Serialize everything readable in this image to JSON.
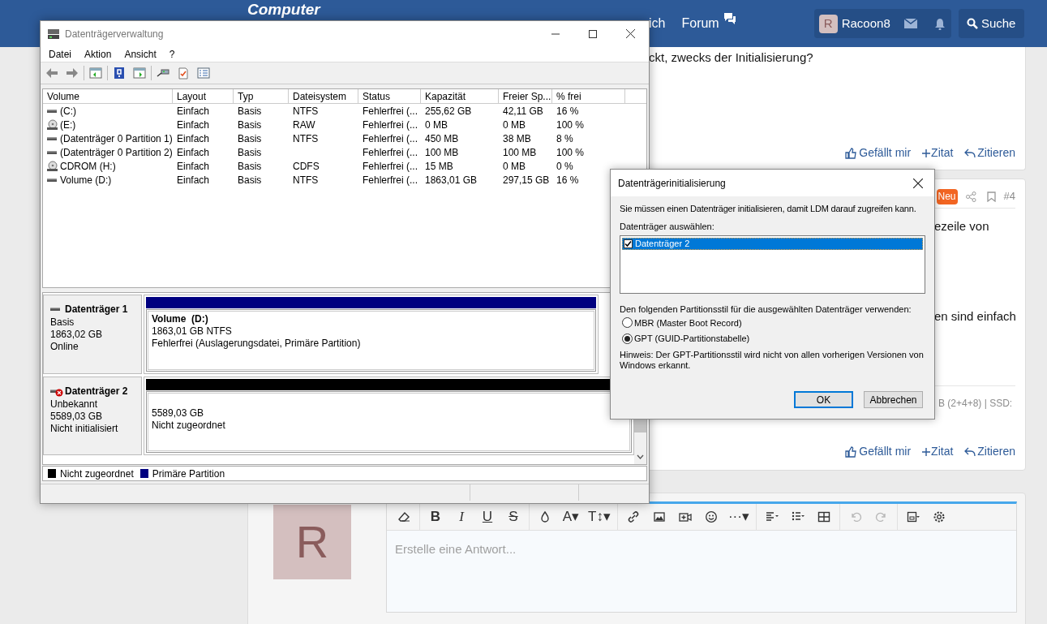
{
  "forum": {
    "logo": "Computer",
    "nav": [
      "ich",
      "Forum"
    ],
    "user": {
      "initial": "R",
      "name": "Racoon8"
    },
    "search": "Suche",
    "post1": {
      "text": "ckt, zwecks der Initialisierung?",
      "actions": [
        "Gefällt mir",
        "Zitat",
        "Zitieren"
      ]
    },
    "post2": {
      "badge": "Neu",
      "number": "#4",
      "lines": [
        "ezeile von",
        "en sind einfach"
      ],
      "signature": "B (2+4+8) | SSD:",
      "actions": [
        "Gefällt mir",
        "Zitat",
        "Zitieren"
      ]
    },
    "reply": {
      "avatar": "R",
      "placeholder": "Erstelle eine Antwort...",
      "tools": [
        {
          "kind": "eraser",
          "disabled": false
        },
        {
          "kind": "text",
          "label": "B",
          "disabled": false
        },
        {
          "kind": "text",
          "label": "I",
          "disabled": false
        },
        {
          "kind": "text",
          "label": "U",
          "disabled": false
        },
        {
          "kind": "text",
          "label": "S",
          "disabled": false
        },
        {
          "kind": "drop",
          "disabled": false
        },
        {
          "kind": "text",
          "label": "A▾",
          "disabled": false
        },
        {
          "kind": "text",
          "label": "T↕▾",
          "disabled": false
        },
        {
          "kind": "link",
          "disabled": false
        },
        {
          "kind": "image",
          "disabled": false
        },
        {
          "kind": "video",
          "disabled": false
        },
        {
          "kind": "smiley",
          "disabled": false
        },
        {
          "kind": "text",
          "label": "···▾",
          "disabled": false
        },
        {
          "kind": "align",
          "disabled": false
        },
        {
          "kind": "list",
          "disabled": false
        },
        {
          "kind": "table",
          "disabled": false
        },
        {
          "kind": "undo",
          "disabled": true
        },
        {
          "kind": "redo",
          "disabled": true
        },
        {
          "kind": "save",
          "disabled": false
        },
        {
          "kind": "gear",
          "disabled": false
        }
      ]
    }
  },
  "disk_window": {
    "title": "Datenträgerverwaltung",
    "menu": [
      "Datei",
      "Aktion",
      "Ansicht",
      "?"
    ],
    "columns": [
      "Volume",
      "Layout",
      "Typ",
      "Dateisystem",
      "Status",
      "Kapazität",
      "Freier Sp...",
      "% frei"
    ],
    "rows": [
      {
        "kind": "drive",
        "cells": [
          "(C:)",
          "Einfach",
          "Basis",
          "NTFS",
          "Fehlerfrei (...",
          "255,62 GB",
          "42,11 GB",
          "16 %"
        ]
      },
      {
        "kind": "cdrom",
        "cells": [
          "(E:)",
          "Einfach",
          "Basis",
          "RAW",
          "Fehlerfrei (...",
          "0 MB",
          "0 MB",
          "100 %"
        ]
      },
      {
        "kind": "drive",
        "cells": [
          "(Datenträger 0 Partition 1)",
          "Einfach",
          "Basis",
          "NTFS",
          "Fehlerfrei (...",
          "450 MB",
          "38 MB",
          "8 %"
        ]
      },
      {
        "kind": "drive",
        "cells": [
          "(Datenträger 0 Partition 2)",
          "Einfach",
          "Basis",
          "",
          "Fehlerfrei (...",
          "100 MB",
          "100 MB",
          "100 %"
        ]
      },
      {
        "kind": "cdrom",
        "cells": [
          "CDROM (H:)",
          "Einfach",
          "Basis",
          "CDFS",
          "Fehlerfrei (...",
          "15 MB",
          "0 MB",
          "0 %"
        ]
      },
      {
        "kind": "drive",
        "cells": [
          "Volume (D:)",
          "Einfach",
          "Basis",
          "NTFS",
          "Fehlerfrei (...",
          "1863,01 GB",
          "297,15 GB",
          "16 %"
        ]
      }
    ],
    "disks": [
      {
        "name": "Datenträger 1",
        "error": false,
        "info": [
          "Basis",
          "1863,02 GB",
          "Online"
        ],
        "partition": {
          "kind": "primary",
          "title": "Volume  (D:)",
          "lines": [
            "1863,01 GB NTFS",
            "Fehlerfrei (Auslagerungsdatei, Primäre Partition)"
          ]
        }
      },
      {
        "name": "Datenträger 2",
        "error": true,
        "info": [
          "Unbekannt",
          "5589,03 GB",
          "Nicht initialisiert"
        ],
        "partition": {
          "kind": "unallocated",
          "lines": [
            "5589,03 GB",
            "Nicht zugeordnet"
          ]
        }
      }
    ],
    "legend": [
      {
        "kind": "unallocated",
        "label": "Nicht zugeordnet"
      },
      {
        "kind": "primary",
        "label": "Primäre Partition"
      }
    ]
  },
  "dialog": {
    "title": "Datenträgerinitialisierung",
    "message": "Sie müssen einen Datenträger initialisieren, damit LDM darauf zugreifen kann.",
    "select_label": "Datenträger auswählen:",
    "disks": [
      {
        "label": "Datenträger 2",
        "checked": true,
        "selected": true
      }
    ],
    "style_label": "Den folgenden Partitionsstil für die ausgewählten Datenträger verwenden:",
    "styles": [
      {
        "label": "MBR (Master Boot Record)",
        "selected": false
      },
      {
        "label": "GPT (GUID-Partitionstabelle)",
        "selected": true
      }
    ],
    "hint": "Hinweis: Der GPT-Partitionsstil wird nicht von allen vorherigen Versionen von Windows erkannt.",
    "buttons": [
      {
        "label": "OK",
        "default": true
      },
      {
        "label": "Abbrechen",
        "default": false
      }
    ]
  }
}
